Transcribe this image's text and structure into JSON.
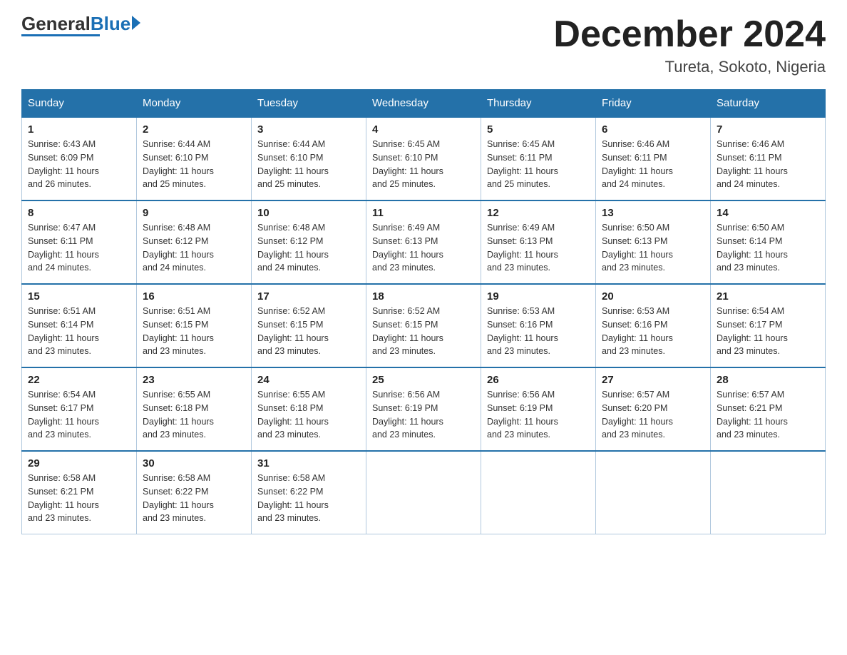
{
  "header": {
    "logo_general": "General",
    "logo_blue": "Blue",
    "month_title": "December 2024",
    "location": "Tureta, Sokoto, Nigeria"
  },
  "days_of_week": [
    "Sunday",
    "Monday",
    "Tuesday",
    "Wednesday",
    "Thursday",
    "Friday",
    "Saturday"
  ],
  "weeks": [
    [
      {
        "num": "1",
        "sunrise": "6:43 AM",
        "sunset": "6:09 PM",
        "daylight": "11 hours and 26 minutes."
      },
      {
        "num": "2",
        "sunrise": "6:44 AM",
        "sunset": "6:10 PM",
        "daylight": "11 hours and 25 minutes."
      },
      {
        "num": "3",
        "sunrise": "6:44 AM",
        "sunset": "6:10 PM",
        "daylight": "11 hours and 25 minutes."
      },
      {
        "num": "4",
        "sunrise": "6:45 AM",
        "sunset": "6:10 PM",
        "daylight": "11 hours and 25 minutes."
      },
      {
        "num": "5",
        "sunrise": "6:45 AM",
        "sunset": "6:11 PM",
        "daylight": "11 hours and 25 minutes."
      },
      {
        "num": "6",
        "sunrise": "6:46 AM",
        "sunset": "6:11 PM",
        "daylight": "11 hours and 24 minutes."
      },
      {
        "num": "7",
        "sunrise": "6:46 AM",
        "sunset": "6:11 PM",
        "daylight": "11 hours and 24 minutes."
      }
    ],
    [
      {
        "num": "8",
        "sunrise": "6:47 AM",
        "sunset": "6:11 PM",
        "daylight": "11 hours and 24 minutes."
      },
      {
        "num": "9",
        "sunrise": "6:48 AM",
        "sunset": "6:12 PM",
        "daylight": "11 hours and 24 minutes."
      },
      {
        "num": "10",
        "sunrise": "6:48 AM",
        "sunset": "6:12 PM",
        "daylight": "11 hours and 24 minutes."
      },
      {
        "num": "11",
        "sunrise": "6:49 AM",
        "sunset": "6:13 PM",
        "daylight": "11 hours and 23 minutes."
      },
      {
        "num": "12",
        "sunrise": "6:49 AM",
        "sunset": "6:13 PM",
        "daylight": "11 hours and 23 minutes."
      },
      {
        "num": "13",
        "sunrise": "6:50 AM",
        "sunset": "6:13 PM",
        "daylight": "11 hours and 23 minutes."
      },
      {
        "num": "14",
        "sunrise": "6:50 AM",
        "sunset": "6:14 PM",
        "daylight": "11 hours and 23 minutes."
      }
    ],
    [
      {
        "num": "15",
        "sunrise": "6:51 AM",
        "sunset": "6:14 PM",
        "daylight": "11 hours and 23 minutes."
      },
      {
        "num": "16",
        "sunrise": "6:51 AM",
        "sunset": "6:15 PM",
        "daylight": "11 hours and 23 minutes."
      },
      {
        "num": "17",
        "sunrise": "6:52 AM",
        "sunset": "6:15 PM",
        "daylight": "11 hours and 23 minutes."
      },
      {
        "num": "18",
        "sunrise": "6:52 AM",
        "sunset": "6:15 PM",
        "daylight": "11 hours and 23 minutes."
      },
      {
        "num": "19",
        "sunrise": "6:53 AM",
        "sunset": "6:16 PM",
        "daylight": "11 hours and 23 minutes."
      },
      {
        "num": "20",
        "sunrise": "6:53 AM",
        "sunset": "6:16 PM",
        "daylight": "11 hours and 23 minutes."
      },
      {
        "num": "21",
        "sunrise": "6:54 AM",
        "sunset": "6:17 PM",
        "daylight": "11 hours and 23 minutes."
      }
    ],
    [
      {
        "num": "22",
        "sunrise": "6:54 AM",
        "sunset": "6:17 PM",
        "daylight": "11 hours and 23 minutes."
      },
      {
        "num": "23",
        "sunrise": "6:55 AM",
        "sunset": "6:18 PM",
        "daylight": "11 hours and 23 minutes."
      },
      {
        "num": "24",
        "sunrise": "6:55 AM",
        "sunset": "6:18 PM",
        "daylight": "11 hours and 23 minutes."
      },
      {
        "num": "25",
        "sunrise": "6:56 AM",
        "sunset": "6:19 PM",
        "daylight": "11 hours and 23 minutes."
      },
      {
        "num": "26",
        "sunrise": "6:56 AM",
        "sunset": "6:19 PM",
        "daylight": "11 hours and 23 minutes."
      },
      {
        "num": "27",
        "sunrise": "6:57 AM",
        "sunset": "6:20 PM",
        "daylight": "11 hours and 23 minutes."
      },
      {
        "num": "28",
        "sunrise": "6:57 AM",
        "sunset": "6:21 PM",
        "daylight": "11 hours and 23 minutes."
      }
    ],
    [
      {
        "num": "29",
        "sunrise": "6:58 AM",
        "sunset": "6:21 PM",
        "daylight": "11 hours and 23 minutes."
      },
      {
        "num": "30",
        "sunrise": "6:58 AM",
        "sunset": "6:22 PM",
        "daylight": "11 hours and 23 minutes."
      },
      {
        "num": "31",
        "sunrise": "6:58 AM",
        "sunset": "6:22 PM",
        "daylight": "11 hours and 23 minutes."
      },
      null,
      null,
      null,
      null
    ]
  ],
  "labels": {
    "sunrise": "Sunrise:",
    "sunset": "Sunset:",
    "daylight": "Daylight:"
  }
}
